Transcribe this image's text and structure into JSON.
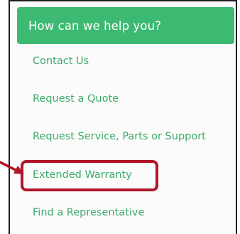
{
  "header": {
    "title": "How can we help you?"
  },
  "menu": {
    "items": [
      {
        "label": "Contact Us"
      },
      {
        "label": "Request a Quote"
      },
      {
        "label": "Request Service, Parts or Support"
      },
      {
        "label": "Extended Warranty"
      },
      {
        "label": "Find a Representative"
      }
    ]
  },
  "colors": {
    "header_bg": "#3dba72",
    "link": "#3daa6c",
    "annotation": "#b0162a"
  },
  "icons": {
    "annotation_arrow": "arrow-icon"
  }
}
